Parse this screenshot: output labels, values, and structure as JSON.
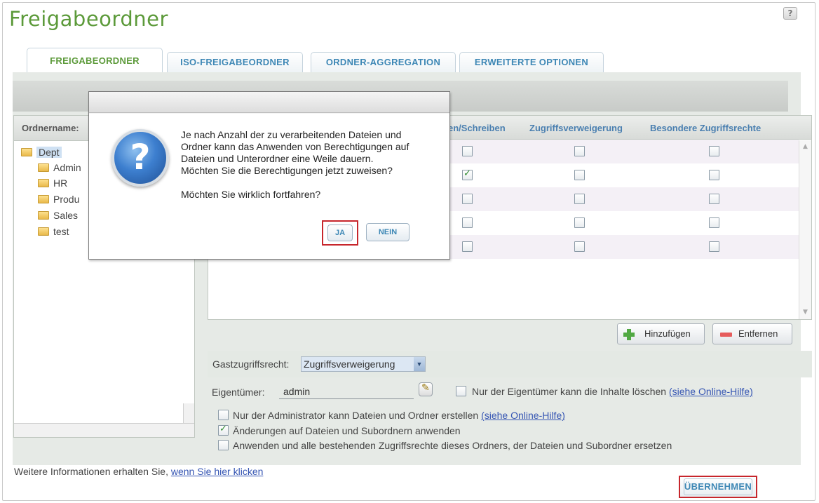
{
  "page": {
    "title": "Freigabeordner",
    "help_icon": "?"
  },
  "tabs": [
    {
      "label": "FREIGABEORDNER",
      "active": true
    },
    {
      "label": "ISO-FREIGABEORDNER",
      "active": false
    },
    {
      "label": "ORDNER-AGGREGATION",
      "active": false
    },
    {
      "label": "ERWEITERTE OPTIONEN",
      "active": false
    }
  ],
  "tree": {
    "header": "Ordnername:",
    "root": "Dept",
    "children": [
      "Admin",
      "HR",
      "Produ",
      "Sales",
      "test"
    ]
  },
  "grid": {
    "columns": [
      "en/Schreiben",
      "Zugriffsverweigerung",
      "Besondere Zugriffsrechte"
    ],
    "rows": [
      {
        "read_write": false,
        "deny": false,
        "special": false
      },
      {
        "read_write": true,
        "deny": false,
        "special": false
      },
      {
        "read_write": false,
        "deny": false,
        "special": false
      },
      {
        "read_write": false,
        "deny": false,
        "special": false
      },
      {
        "read_write": false,
        "deny": false,
        "special": false
      }
    ]
  },
  "buttons": {
    "add": "Hinzufügen",
    "remove": "Entfernen",
    "apply": "ÜBERNEHMEN"
  },
  "guest": {
    "label": "Gastzugriffsrecht:",
    "value": "Zugriffsverweigerung"
  },
  "owner": {
    "label": "Eigentümer:",
    "value": "admin",
    "only_owner_delete": "Nur der Eigentümer kann die Inhalte löschen",
    "only_owner_delete_checked": false,
    "help_link": "(siehe Online-Hilfe)"
  },
  "options": [
    {
      "text": "Nur der Administrator kann Dateien und Ordner erstellen",
      "link": "(siehe Online-Hilfe)",
      "checked": false
    },
    {
      "text": "Änderungen auf Dateien und Subordnern anwenden",
      "link": "",
      "checked": true
    },
    {
      "text": "Anwenden und alle bestehenden Zugriffsrechte dieses Ordners, der Dateien und Subordner ersetzen",
      "link": "",
      "checked": false
    }
  ],
  "footer": {
    "info_text": "Weitere Informationen erhalten Sie,",
    "info_link": "wenn Sie hier klicken"
  },
  "modal": {
    "icon": "question-icon",
    "icon_glyph": "?",
    "lines": [
      "Je nach Anzahl der zu verarbeitenden Dateien und",
      "Ordner kann das Anwenden von Berechtigungen auf",
      "Dateien und Unterordner eine Weile dauern.",
      "Möchten Sie die Berechtigungen jetzt zuweisen?"
    ],
    "question": "Möchten Sie wirklich fortfahren?",
    "yes": "JA",
    "no": "NEIN"
  },
  "colors": {
    "accent_green": "#5c9a3a",
    "accent_blue": "#3d87b5",
    "highlight_red": "#c7262c"
  }
}
